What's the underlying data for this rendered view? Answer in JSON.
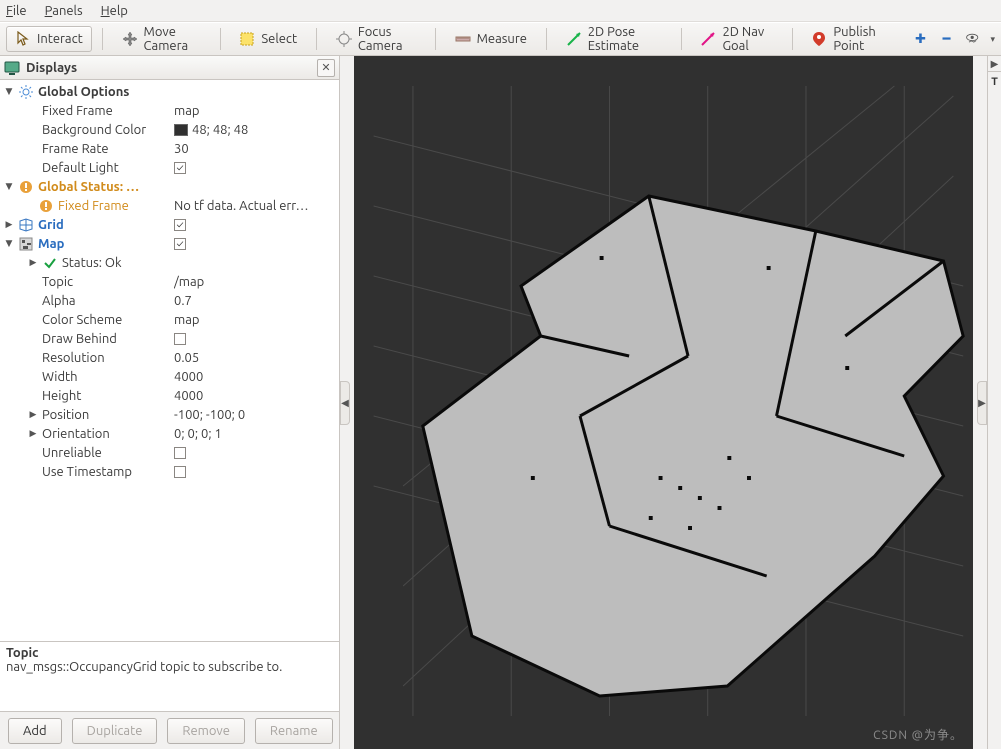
{
  "menus": {
    "file": "File",
    "panels": "Panels",
    "help": "Help"
  },
  "toolbar": {
    "interact": "Interact",
    "move_camera": "Move Camera",
    "select": "Select",
    "focus_camera": "Focus Camera",
    "measure": "Measure",
    "pose_estimate": "2D Pose Estimate",
    "nav_goal": "2D Nav Goal",
    "publish_point": "Publish Point"
  },
  "panel": {
    "title": "Displays"
  },
  "tree": {
    "global_options": "Global Options",
    "fixed_frame_label": "Fixed Frame",
    "fixed_frame_value": "map",
    "background_color_label": "Background Color",
    "background_color_value": "48; 48; 48",
    "frame_rate_label": "Frame Rate",
    "frame_rate_value": "30",
    "default_light_label": "Default Light",
    "global_status": "Global Status: …",
    "global_status_item_label": "Fixed Frame",
    "global_status_item_value": "No tf data.  Actual err…",
    "grid": "Grid",
    "map": "Map",
    "map_status": "Status: Ok",
    "topic_label": "Topic",
    "topic_value": "/map",
    "alpha_label": "Alpha",
    "alpha_value": "0.7",
    "color_scheme_label": "Color Scheme",
    "color_scheme_value": "map",
    "draw_behind_label": "Draw Behind",
    "resolution_label": "Resolution",
    "resolution_value": "0.05",
    "width_label": "Width",
    "width_value": "4000",
    "height_label": "Height",
    "height_value": "4000",
    "position_label": "Position",
    "position_value": "-100; -100; 0",
    "orientation_label": "Orientation",
    "orientation_value": "0; 0; 0; 1",
    "unreliable_label": "Unreliable",
    "use_timestamp_label": "Use Timestamp"
  },
  "description": {
    "title": "Topic",
    "body": "nav_msgs::OccupancyGrid topic to subscribe to."
  },
  "buttons": {
    "add": "Add",
    "duplicate": "Duplicate",
    "remove": "Remove",
    "rename": "Rename"
  },
  "right": {
    "tab": "T"
  },
  "watermark": "CSDN @为争。"
}
